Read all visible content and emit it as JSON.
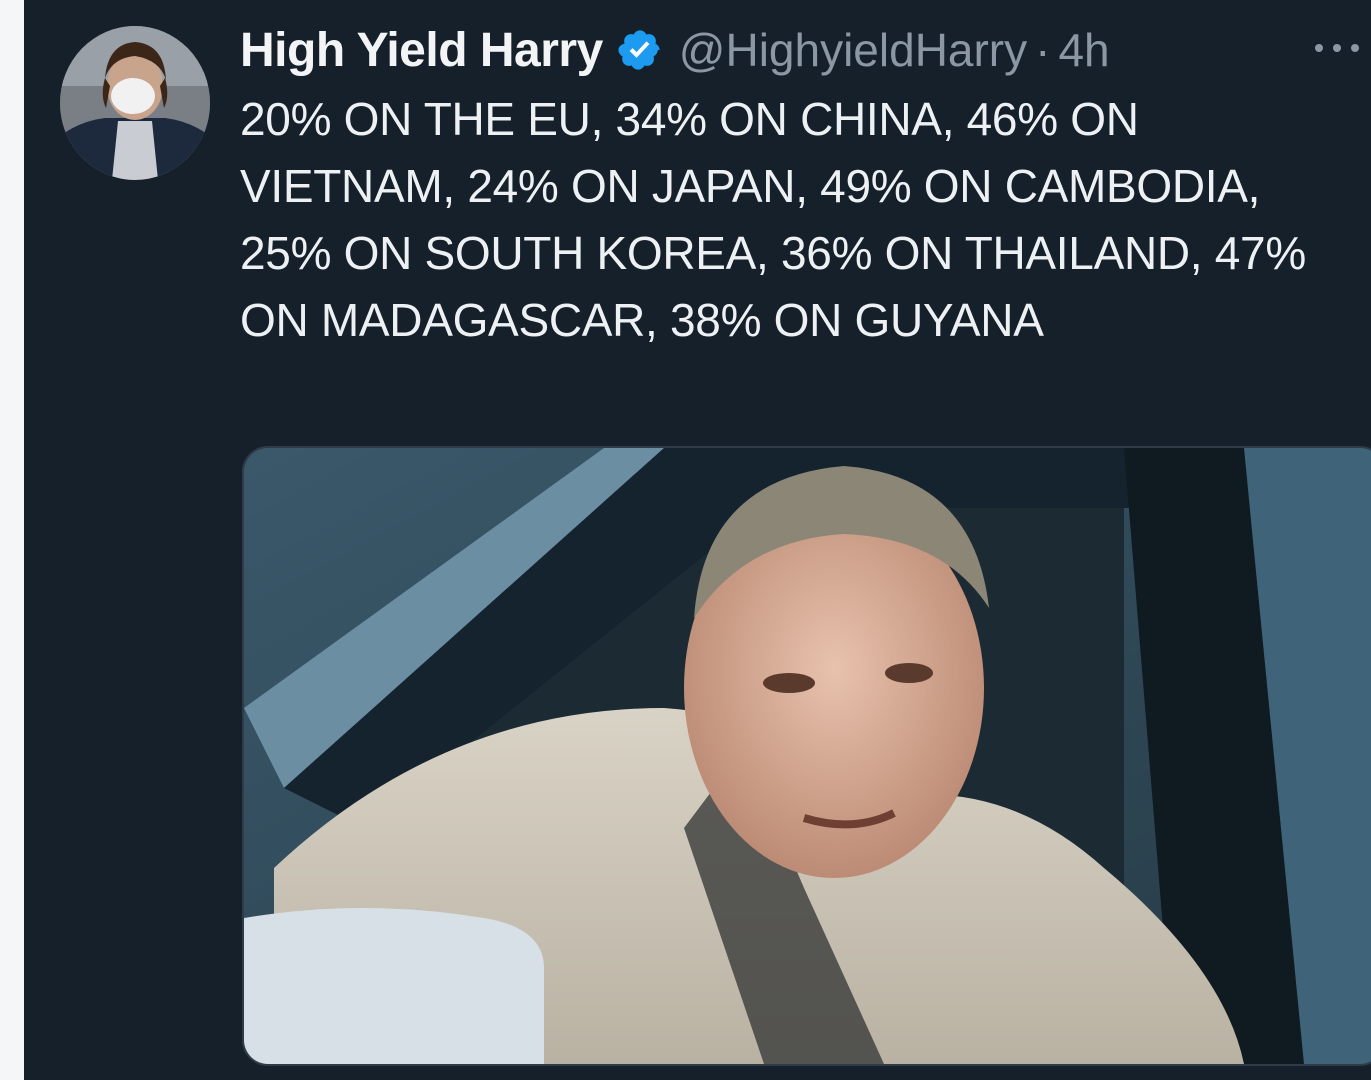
{
  "tweet": {
    "author": {
      "display_name": "High Yield Harry",
      "handle": "@HighyieldHarry",
      "verified": true,
      "avatar_icon": "profile-photo"
    },
    "separator": "·",
    "time": "4h",
    "more_icon": "more-dots-icon",
    "text": "20% ON THE EU, 34% ON CHINA, 46% ON VIETNAM, 24% ON JAPAN, 49% ON CAMBODIA, 25% ON SOUTH KOREA, 36% ON THAILAND, 47% ON MADAGASCAR, 38% ON GUYANA",
    "media": {
      "type": "photo"
    }
  },
  "colors": {
    "background": "#16202b",
    "name": "#f2f4f6",
    "secondary": "#8b97a3",
    "verified": "#1d9bf0"
  }
}
